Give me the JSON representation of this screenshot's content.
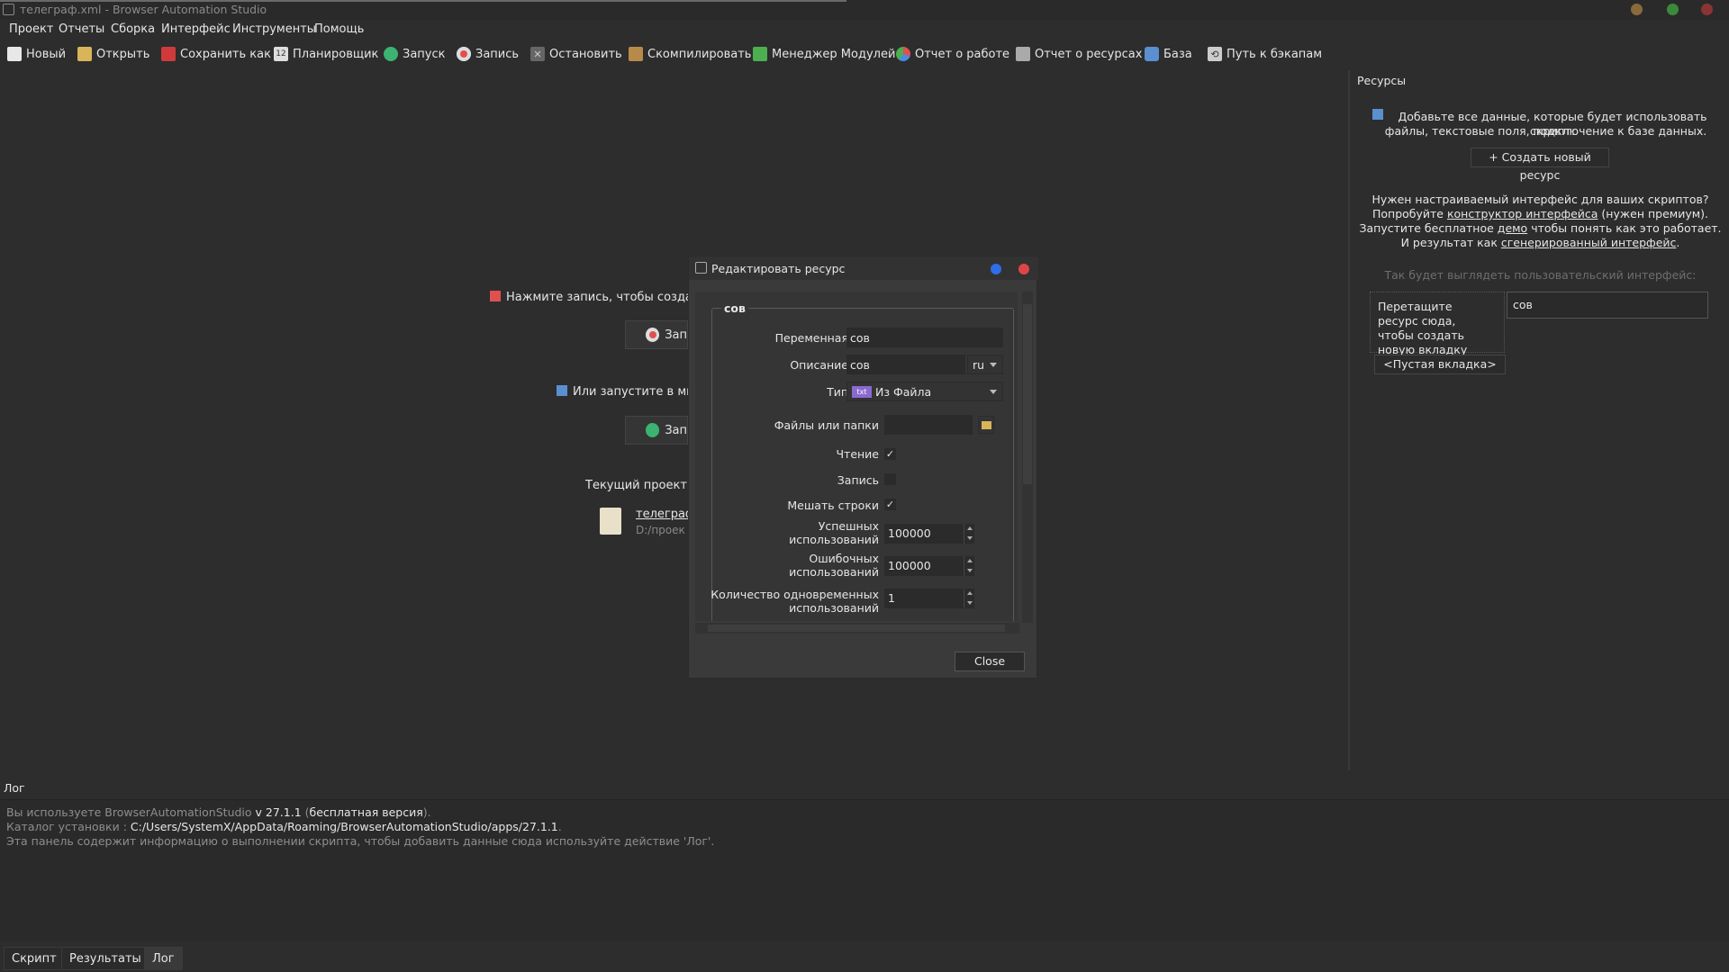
{
  "window": {
    "title": "телеграф.xml - Browser Automation Studio"
  },
  "menu": [
    "Проект",
    "Отчеты",
    "Сборка",
    "Интерфейс",
    "Инструменты",
    "Помощь"
  ],
  "toolbar": {
    "new": "Новый",
    "open": "Открыть",
    "save_as": "Сохранить как",
    "scheduler": "Планировщик",
    "run": "Запуск",
    "record": "Запись",
    "stop": "Остановить",
    "compile": "Скомпилировать",
    "module_manager": "Менеджер Модулей",
    "work_report": "Отчет о работе",
    "resource_report": "Отчет о ресурсах",
    "database": "База",
    "backup_path": "Путь к бэкапам",
    "scheduler_icon_text": "12"
  },
  "welcome": {
    "record_hint": "Нажмите запись, чтобы создать",
    "record_button": "Зап",
    "run_hint": "Или запустите в мно",
    "run_button": "Зап",
    "current_project_label": "Текущий проект:",
    "project_name": "телеграф",
    "project_path": "D:/проек"
  },
  "dialog": {
    "title": "Редактировать ресурс",
    "group_title": "сов",
    "fields": {
      "variable_label": "Переменная",
      "variable_value": "сов",
      "description_label": "Описание",
      "description_value": "сов",
      "lang_value": "ru",
      "type_label": "Тип",
      "type_value": "Из Файла",
      "type_icon_text": "txt",
      "files_label": "Файлы или папки",
      "files_value": "",
      "read_label": "Чтение",
      "read_checked": true,
      "write_label": "Запись",
      "write_checked": false,
      "shuffle_label": "Мешать строки",
      "shuffle_checked": true,
      "success_label": "Успешных использований",
      "success_value": "100000",
      "fail_label": "Ошибочных использований",
      "fail_value": "100000",
      "concurrent_label": "Количество одновременных использований",
      "concurrent_value": "1"
    },
    "close_button": "Close"
  },
  "resources_panel": {
    "title": "Ресурсы",
    "hint_line1": "Добавьте все данные, которые будет использовать скрипт:",
    "hint_line2": "файлы, текстовые поля, подключение к базе данных.",
    "create_button": "+ Создать новый ресурс",
    "promo": {
      "line1": "Нужен настраиваемый интерфейс для ваших скриптов?",
      "line2_pre": "Попробуйте ",
      "line2_link": "конструктор интерфейса",
      "line2_post": " (нужен премиум).",
      "line3_pre": "Запустите бесплатное ",
      "line3_link": "демо",
      "line3_post": " чтобы понять как это работает.",
      "line4_pre": "И результат как ",
      "line4_link": "сгенерированный интерфейс",
      "line4_post": "."
    },
    "preview_label": "Так будет выглядеть пользовательский интерфейс:",
    "drop_hint": "Перетащите ресурс сюда, чтобы создать новую вкладку",
    "preview_input_value": "сов",
    "empty_tab": "<Пустая вкладка>"
  },
  "log": {
    "header": "Лог",
    "line1_pre": "Вы используете BrowserAutomationStudio ",
    "line1_version": "v 27.1.1",
    "line1_mid": " (",
    "line1_edition": "бесплатная версия",
    "line1_post": ").",
    "line2_pre": "Каталог установки : ",
    "line2_path": "C:/Users/SystemX/AppData/Roaming/BrowserAutomationStudio/apps/27.1.1",
    "line2_post": ".",
    "line3": "Эта панель содержит информацию о выполнении скрипта, чтобы добавить данные сюда используйте действие 'Лог'."
  },
  "bottom_tabs": [
    "Скрипт",
    "Результаты",
    "Лог"
  ],
  "colors": {
    "background": "#2d2d2d",
    "record_red": "#e05050",
    "run_green": "#3cb371",
    "dialog_blue": "#2f6ee8",
    "dialog_red": "#e04545"
  }
}
